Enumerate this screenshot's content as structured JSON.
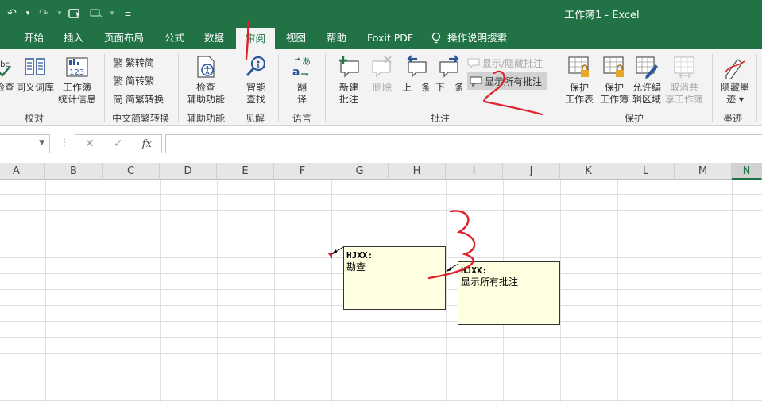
{
  "app": {
    "window_title": "工作簿1  -  Excel"
  },
  "tabs": [
    {
      "id": "home",
      "label": "开始"
    },
    {
      "id": "insert",
      "label": "插入"
    },
    {
      "id": "layout",
      "label": "页面布局"
    },
    {
      "id": "formulas",
      "label": "公式"
    },
    {
      "id": "data",
      "label": "数据"
    },
    {
      "id": "review",
      "label": "审阅",
      "active": true
    },
    {
      "id": "view",
      "label": "视图"
    },
    {
      "id": "help",
      "label": "帮助"
    },
    {
      "id": "foxit",
      "label": "Foxit PDF"
    }
  ],
  "tell_me": "操作说明搜索",
  "ribbon": {
    "proofing": {
      "spell_label": "检查",
      "thesaurus_label": "同义词库",
      "stats_label": "工作簿\n统计信息",
      "group_label": "校对"
    },
    "chinese": {
      "trad_label": "繁转简",
      "simp_label": "简转繁",
      "convert_label": "简繁转换",
      "group_label": "中文简繁转换"
    },
    "accessibility": {
      "check_label": "检查\n辅助功能",
      "group_label": "辅助功能"
    },
    "insights": {
      "smart_label": "智能\n查找",
      "group_label": "见解"
    },
    "language": {
      "translate_label": "翻\n译",
      "group_label": "语言"
    },
    "comments": {
      "new_label": "新建\n批注",
      "delete_label": "删除",
      "prev_label": "上一条",
      "next_label": "下一条",
      "toggle_label": "显示/隐藏批注",
      "show_all_label": "显示所有批注",
      "group_label": "批注"
    },
    "protect": {
      "sheet_label": "保护\n工作表",
      "workbook_label": "保护\n工作簿",
      "ranges_label": "允许编\n辑区域",
      "unshare_label": "取消共\n享工作簿",
      "group_label": "保护"
    },
    "ink": {
      "hide_label": "隐藏墨\n迹 ▾",
      "group_label": "墨迹"
    }
  },
  "formula_bar": {
    "fx_label": "fx",
    "cancel_glyph": "✕",
    "enter_glyph": "✓"
  },
  "columns": [
    "A",
    "B",
    "C",
    "D",
    "E",
    "F",
    "G",
    "H",
    "I",
    "J",
    "K",
    "L",
    "M",
    "N"
  ],
  "comment_boxes": [
    {
      "author": "HJXX:",
      "text": "勘查"
    },
    {
      "author": "HJXX:",
      "text": "显示所有批注"
    }
  ],
  "annotations": {
    "mark_1": "1",
    "mark_2": "2",
    "mark_3": "3"
  },
  "colors": {
    "accent": "#217346",
    "comment_bg": "#ffffe1",
    "ink": "#e0202a"
  }
}
